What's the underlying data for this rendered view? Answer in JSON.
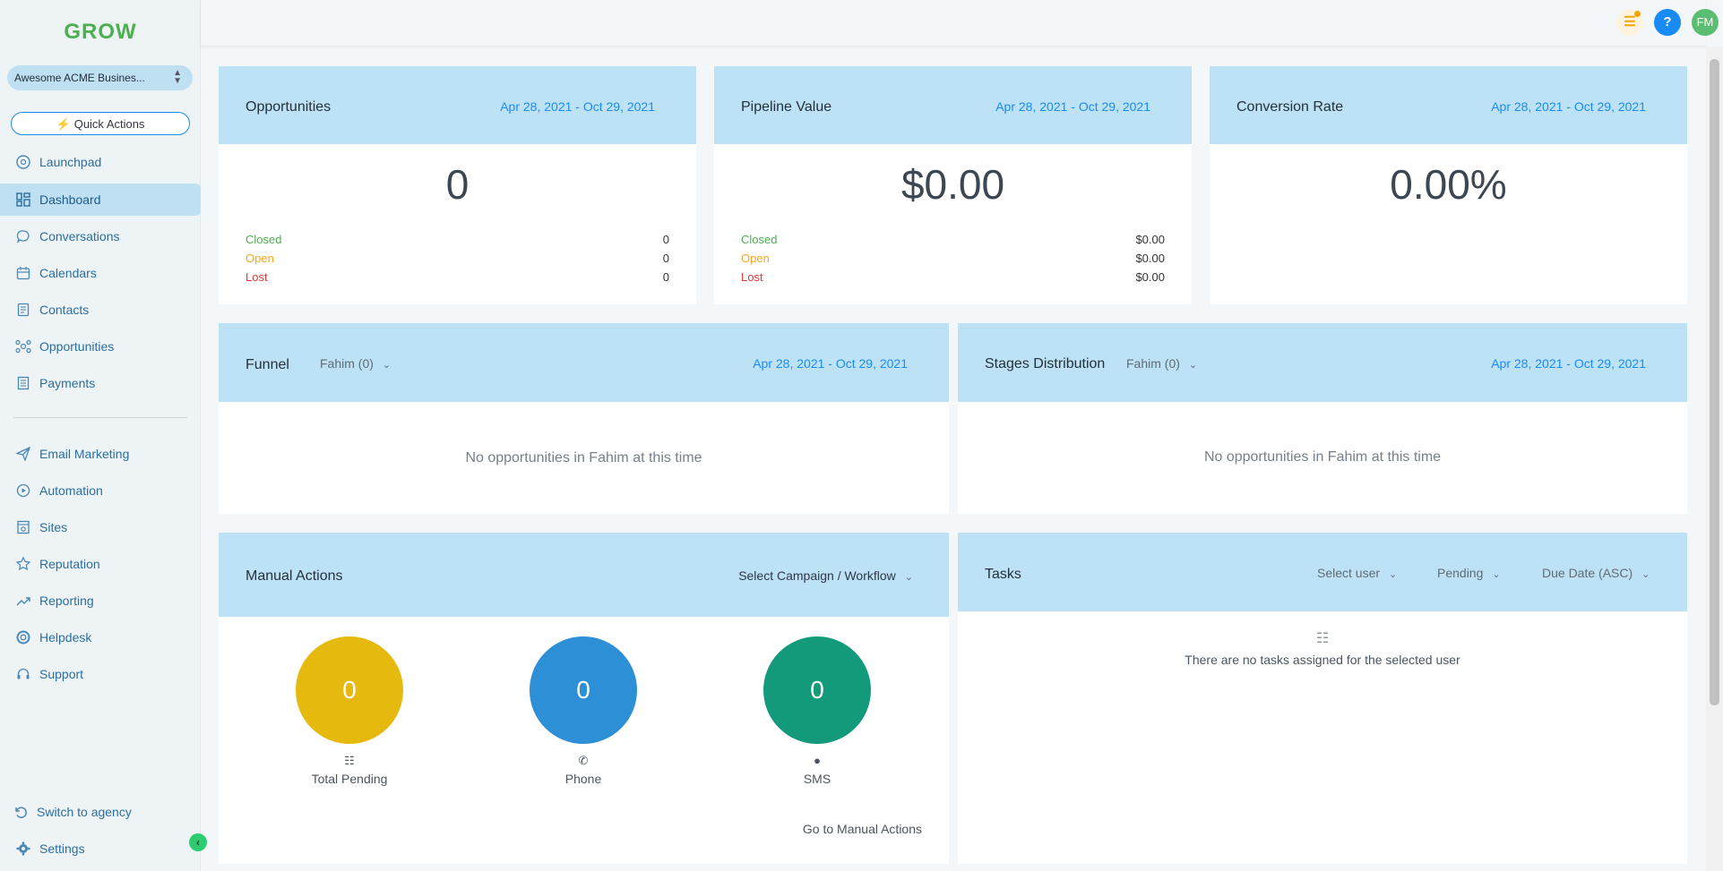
{
  "sidebar": {
    "logo": "GROW",
    "location": "Awesome ACME Busines...",
    "quick_actions": "Quick Actions",
    "items": [
      {
        "label": "Launchpad",
        "icon": "launchpad-icon"
      },
      {
        "label": "Dashboard",
        "icon": "dashboard-icon",
        "active": true
      },
      {
        "label": "Conversations",
        "icon": "chat-icon"
      },
      {
        "label": "Calendars",
        "icon": "calendar-icon"
      },
      {
        "label": "Contacts",
        "icon": "contacts-icon"
      },
      {
        "label": "Opportunities",
        "icon": "opportunities-icon"
      },
      {
        "label": "Payments",
        "icon": "payments-icon"
      },
      {
        "label": "Email Marketing",
        "icon": "send-icon"
      },
      {
        "label": "Automation",
        "icon": "automation-icon"
      },
      {
        "label": "Sites",
        "icon": "sites-icon"
      },
      {
        "label": "Reputation",
        "icon": "star-icon"
      },
      {
        "label": "Reporting",
        "icon": "trend-icon"
      },
      {
        "label": "Helpdesk",
        "icon": "lifebuoy-icon"
      },
      {
        "label": "Support",
        "icon": "headset-icon"
      }
    ],
    "switch_agency": "Switch to agency",
    "settings": "Settings"
  },
  "topbar": {
    "avatar": "FM",
    "help": "?"
  },
  "cards": {
    "opportunities": {
      "title": "Opportunities",
      "date": "Apr 28, 2021 - Oct 29, 2021",
      "total": "0",
      "rows": [
        {
          "label": "Closed",
          "value": "0"
        },
        {
          "label": "Open",
          "value": "0"
        },
        {
          "label": "Lost",
          "value": "0"
        }
      ]
    },
    "pipeline": {
      "title": "Pipeline Value",
      "date": "Apr 28, 2021 - Oct 29, 2021",
      "total": "$0.00",
      "rows": [
        {
          "label": "Closed",
          "value": "$0.00"
        },
        {
          "label": "Open",
          "value": "$0.00"
        },
        {
          "label": "Lost",
          "value": "$0.00"
        }
      ]
    },
    "conversion": {
      "title": "Conversion Rate",
      "date": "Apr 28, 2021 - Oct 29, 2021",
      "total": "0.00%"
    },
    "funnel": {
      "title": "Funnel",
      "filter": "Fahim (0)",
      "date": "Apr 28, 2021 - Oct 29, 2021",
      "empty": "No opportunities in Fahim at this time"
    },
    "stages": {
      "title": "Stages Distribution",
      "filter": "Fahim (0)",
      "date": "Apr 28, 2021 - Oct 29, 2021",
      "empty": "No opportunities in Fahim at this time"
    },
    "manual": {
      "title": "Manual Actions",
      "select": "Select Campaign / Workflow",
      "circles": [
        {
          "value": "0",
          "label": "Total Pending",
          "color": "#e6b90e"
        },
        {
          "value": "0",
          "label": "Phone",
          "color": "#2d8fd6"
        },
        {
          "value": "0",
          "label": "SMS",
          "color": "#139a7a"
        }
      ],
      "link": "Go to Manual Actions"
    },
    "tasks": {
      "title": "Tasks",
      "select_user": "Select user",
      "status": "Pending",
      "sort": "Due Date (ASC)",
      "empty": "There are no tasks assigned for the selected user"
    }
  }
}
